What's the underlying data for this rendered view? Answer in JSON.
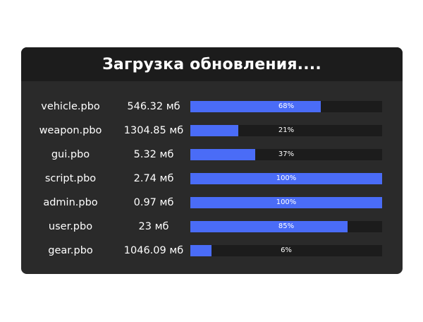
{
  "title": "Загрузка обновления....",
  "colors": {
    "panel_bg": "#2a2a2a",
    "header_bg": "#1c1c1c",
    "track_bg": "#1c1c1c",
    "bar_fill": "#4a6cf7",
    "text": "#ffffff"
  },
  "files": [
    {
      "name": "vehicle.pbo",
      "size": "546.32 мб",
      "percent_label": "68%",
      "progress": 0.68
    },
    {
      "name": "weapon.pbo",
      "size": "1304.85 мб",
      "percent_label": "21%",
      "progress": 0.25
    },
    {
      "name": "gui.pbo",
      "size": "5.32 мб",
      "percent_label": "37%",
      "progress": 0.34
    },
    {
      "name": "script.pbo",
      "size": "2.74 мб",
      "percent_label": "100%",
      "progress": 1.0
    },
    {
      "name": "admin.pbo",
      "size": "0.97 мб",
      "percent_label": "100%",
      "progress": 1.0
    },
    {
      "name": "user.pbo",
      "size": "23 мб",
      "percent_label": "85%",
      "progress": 0.82
    },
    {
      "name": "gear.pbo",
      "size": "1046.09 мб",
      "percent_label": "6%",
      "progress": 0.11
    }
  ]
}
